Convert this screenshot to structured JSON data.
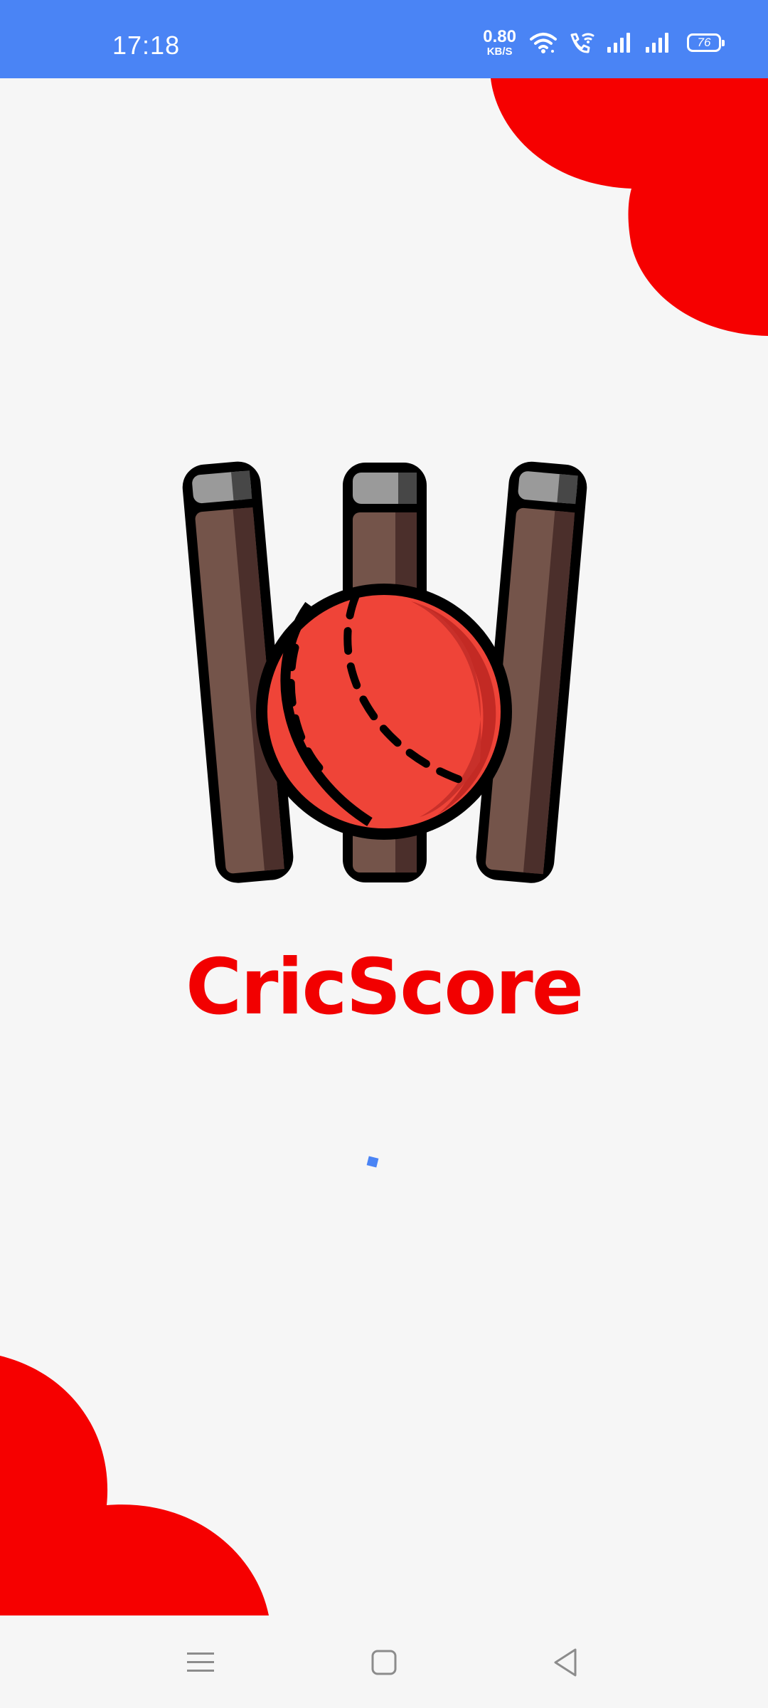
{
  "status_bar": {
    "time": "17:18",
    "net_speed_value": "0.80",
    "net_speed_unit": "KB/S",
    "battery_level": "76",
    "icons": [
      "wifi-icon",
      "wifi-call-icon",
      "signal-icon",
      "signal-icon",
      "battery-icon"
    ]
  },
  "splash": {
    "app_name": "CricScore",
    "logo_icon": "cricket-stumps-ball-icon",
    "loading_indicator": "loading-spinner"
  },
  "colors": {
    "status_bar": "#4a84f5",
    "accent": "#f20000",
    "background": "#f6f6f6",
    "ball": "#ef4438",
    "stump": "#74544a"
  },
  "nav_bar": {
    "icons": [
      "menu-icon",
      "home-icon",
      "back-icon"
    ]
  }
}
